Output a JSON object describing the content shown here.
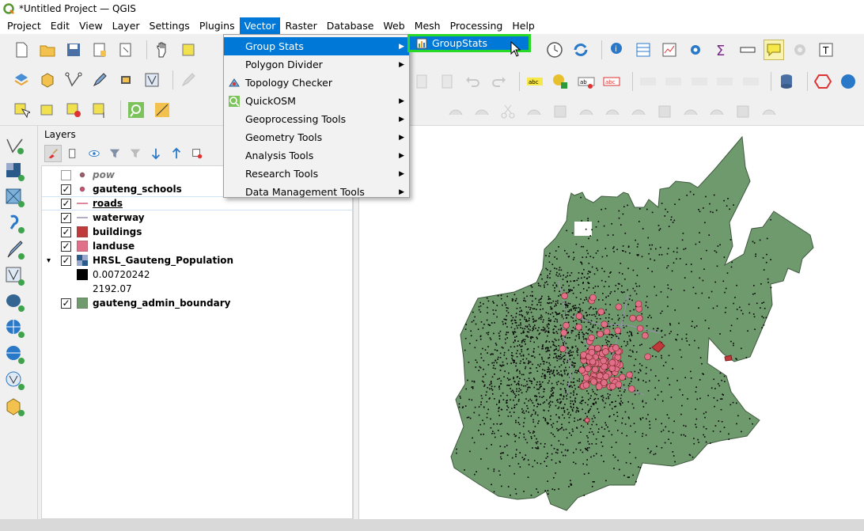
{
  "window": {
    "title": "*Untitled Project — QGIS"
  },
  "menubar": {
    "items": [
      {
        "label": "Project"
      },
      {
        "label": "Edit"
      },
      {
        "label": "View"
      },
      {
        "label": "Layer"
      },
      {
        "label": "Settings"
      },
      {
        "label": "Plugins"
      },
      {
        "label": "Vector"
      },
      {
        "label": "Raster"
      },
      {
        "label": "Database"
      },
      {
        "label": "Web"
      },
      {
        "label": "Mesh"
      },
      {
        "label": "Processing"
      },
      {
        "label": "Help"
      }
    ],
    "active": "Vector"
  },
  "vector_menu": {
    "items": [
      {
        "label": "Group Stats",
        "submenu": true,
        "highlighted": true
      },
      {
        "label": "Polygon Divider",
        "submenu": true
      },
      {
        "label": "Topology Checker",
        "submenu": false,
        "icon": "topology-icon"
      },
      {
        "label": "QuickOSM",
        "submenu": true,
        "icon": "quickosm-icon"
      },
      {
        "label": "Geoprocessing Tools",
        "submenu": true
      },
      {
        "label": "Geometry Tools",
        "submenu": true
      },
      {
        "label": "Analysis Tools",
        "submenu": true
      },
      {
        "label": "Research Tools",
        "submenu": true
      },
      {
        "label": "Data Management Tools",
        "submenu": true
      }
    ]
  },
  "groupstats_submenu": {
    "label": "GroupStats"
  },
  "layers_panel": {
    "title": "Layers",
    "layers": [
      {
        "name": "pow",
        "checked": false,
        "style": "italic",
        "symbol": "point",
        "color": "#9e5a6a"
      },
      {
        "name": "gauteng_schools",
        "checked": true,
        "style": "bold",
        "symbol": "point",
        "color": "#c8506e"
      },
      {
        "name": "roads",
        "checked": true,
        "style": "underline",
        "symbol": "line",
        "color": "#d06080"
      },
      {
        "name": "waterway",
        "checked": true,
        "style": "bold",
        "symbol": "line",
        "color": "#9a8fb0"
      },
      {
        "name": "buildings",
        "checked": true,
        "style": "bold",
        "symbol": "fill",
        "color": "#c0393b"
      },
      {
        "name": "landuse",
        "checked": true,
        "style": "bold",
        "symbol": "fill",
        "color": "#e0708a"
      },
      {
        "name": "HRSL_Gauteng_Population",
        "checked": true,
        "style": "bold",
        "symbol": "raster",
        "expanded": true
      },
      {
        "name": "0.00720242",
        "style": "legend",
        "symbol": "black-box",
        "color": "#000000"
      },
      {
        "name": "2192.07",
        "style": "legend",
        "symbol": "none"
      },
      {
        "name": "gauteng_admin_boundary",
        "checked": true,
        "style": "bold",
        "symbol": "fill",
        "color": "#6f9a6d"
      }
    ]
  },
  "map": {
    "boundary_color": "#6f9a6d",
    "population_color": "#000000",
    "schools_color": "#e0708a",
    "waterway_color": "#9a8fb0"
  }
}
